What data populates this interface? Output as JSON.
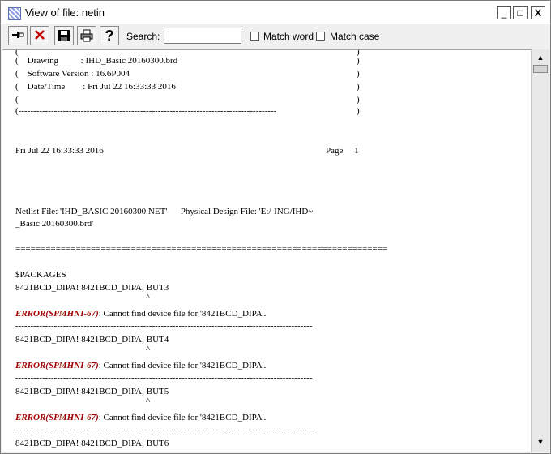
{
  "window": {
    "title": "View of file: netin"
  },
  "titlebar_buttons": {
    "minimize": "_",
    "maximize": "□",
    "close": "X"
  },
  "toolbar": {
    "search_label": "Search:",
    "search_value": "",
    "match_word_label": "Match word",
    "match_case_label": "Match case",
    "match_word_checked": false,
    "match_case_checked": false,
    "buttons": [
      "pin-icon",
      "close-red-icon",
      "save-icon",
      "print-icon",
      "help-icon"
    ]
  },
  "content": {
    "lines": [
      "(",
      "(    Drawing          : IHD_Basic 20160300.brd",
      "(    Software Version : 16.6P004",
      "(    Date/Time        : Fri Jul 22 16:33:33 2016",
      "(",
      "(---------------------------------------------------------------------------------------",
      "Fri Jul 22 16:33:33 2016",
      "Page     1",
      "Netlist File: 'IHD_BASIC 20160300.NET'      Physical Design File: 'E:/-ING/IHD~",
      "_Basic 20160300.brd'",
      "==========================================================================",
      "$PACKAGES",
      "8421BCD_DIPA! 8421BCD_DIPA; BUT3",
      "^",
      ": Cannot find device file for '8421BCD_DIPA'.",
      "----------------------------------------------------------------------------------------------------",
      "8421BCD_DIPA! 8421BCD_DIPA; BUT4",
      "^",
      ": Cannot find device file for '8421BCD_DIPA'.",
      "----------------------------------------------------------------------------------------------------",
      "8421BCD_DIPA! 8421BCD_DIPA; BUT5",
      "^",
      ": Cannot find device file for '8421BCD_DIPA'.",
      "----------------------------------------------------------------------------------------------------",
      "8421BCD_DIPA! 8421BCD_DIPA; BUT6"
    ],
    "right_parens": [
      ")",
      ")",
      ")",
      ")",
      ")",
      ")"
    ],
    "error_code": "ERROR(SPMHNI-67)"
  },
  "colors": {
    "error": "#a00000",
    "background": "#ffffff"
  }
}
